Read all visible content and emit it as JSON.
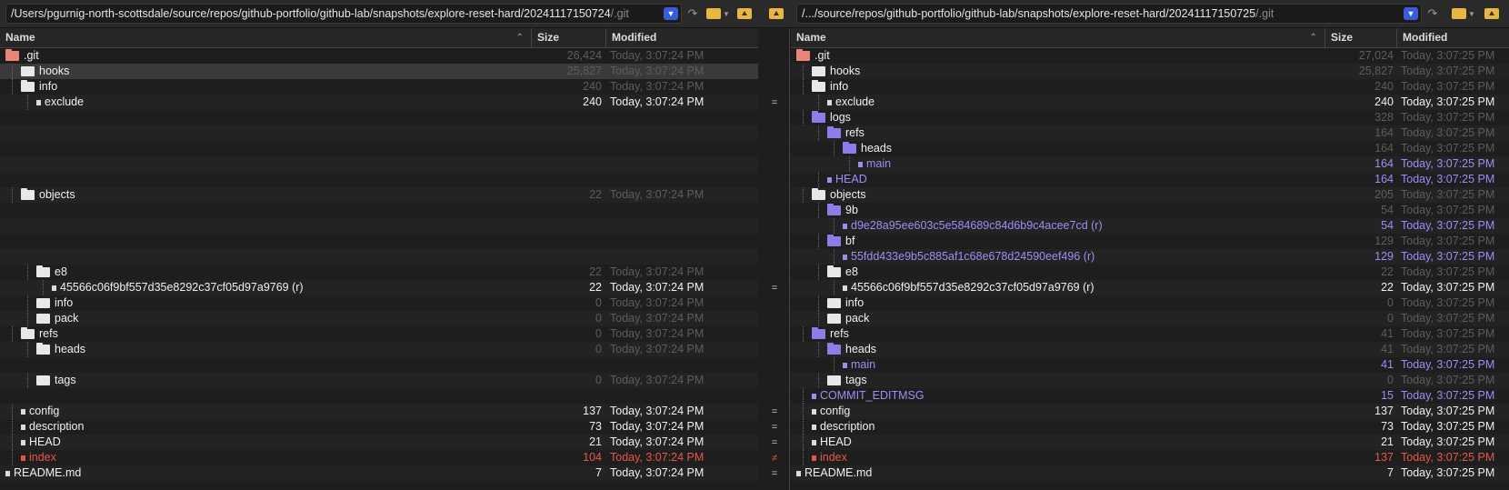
{
  "left": {
    "path_main": "/Users/pgurnig-north-scottsdale/source/repos/github-portfolio/github-lab/snapshots/explore-reset-hard/20241117150724",
    "path_suffix": "/.git",
    "columns": {
      "name": "Name",
      "size": "Size",
      "modified": "Modified"
    },
    "rows": [
      {
        "name": ".git",
        "size": "26,424",
        "mod": "Today, 3:07:24 PM",
        "indent": 0,
        "kind": "folder-git",
        "color": "dim"
      },
      {
        "name": "hooks",
        "size": "25,827",
        "mod": "Today, 3:07:24 PM",
        "indent": 1,
        "kind": "folder",
        "color": "dim",
        "selected": true
      },
      {
        "name": "info",
        "size": "240",
        "mod": "Today, 3:07:24 PM",
        "indent": 1,
        "kind": "folder-open",
        "color": "dim"
      },
      {
        "name": "exclude",
        "size": "240",
        "mod": "Today, 3:07:24 PM",
        "indent": 2,
        "kind": "file",
        "color": "same"
      },
      {
        "name": "",
        "size": "",
        "mod": "",
        "indent": 0,
        "kind": "blank"
      },
      {
        "name": "",
        "size": "",
        "mod": "",
        "indent": 0,
        "kind": "blank"
      },
      {
        "name": "",
        "size": "",
        "mod": "",
        "indent": 0,
        "kind": "blank"
      },
      {
        "name": "",
        "size": "",
        "mod": "",
        "indent": 0,
        "kind": "blank"
      },
      {
        "name": "",
        "size": "",
        "mod": "",
        "indent": 0,
        "kind": "blank"
      },
      {
        "name": "objects",
        "size": "22",
        "mod": "Today, 3:07:24 PM",
        "indent": 1,
        "kind": "folder-open",
        "color": "dim"
      },
      {
        "name": "",
        "size": "",
        "mod": "",
        "indent": 0,
        "kind": "blank"
      },
      {
        "name": "",
        "size": "",
        "mod": "",
        "indent": 0,
        "kind": "blank"
      },
      {
        "name": "",
        "size": "",
        "mod": "",
        "indent": 0,
        "kind": "blank"
      },
      {
        "name": "",
        "size": "",
        "mod": "",
        "indent": 0,
        "kind": "blank"
      },
      {
        "name": "e8",
        "size": "22",
        "mod": "Today, 3:07:24 PM",
        "indent": 2,
        "kind": "folder-open",
        "color": "dim"
      },
      {
        "name": "45566c06f9bf557d35e8292c37cf05d97a9769 (r)",
        "size": "22",
        "mod": "Today, 3:07:24 PM",
        "indent": 3,
        "kind": "file",
        "color": "same"
      },
      {
        "name": "info",
        "size": "0",
        "mod": "Today, 3:07:24 PM",
        "indent": 2,
        "kind": "folder",
        "color": "dim"
      },
      {
        "name": "pack",
        "size": "0",
        "mod": "Today, 3:07:24 PM",
        "indent": 2,
        "kind": "folder",
        "color": "dim"
      },
      {
        "name": "refs",
        "size": "0",
        "mod": "Today, 3:07:24 PM",
        "indent": 1,
        "kind": "folder-open",
        "color": "dim"
      },
      {
        "name": "heads",
        "size": "0",
        "mod": "Today, 3:07:24 PM",
        "indent": 2,
        "kind": "folder-open",
        "color": "dim"
      },
      {
        "name": "",
        "size": "",
        "mod": "",
        "indent": 0,
        "kind": "blank"
      },
      {
        "name": "tags",
        "size": "0",
        "mod": "Today, 3:07:24 PM",
        "indent": 2,
        "kind": "folder",
        "color": "dim"
      },
      {
        "name": "",
        "size": "",
        "mod": "",
        "indent": 0,
        "kind": "blank"
      },
      {
        "name": "config",
        "size": "137",
        "mod": "Today, 3:07:24 PM",
        "indent": 1,
        "kind": "file",
        "color": "same"
      },
      {
        "name": "description",
        "size": "73",
        "mod": "Today, 3:07:24 PM",
        "indent": 1,
        "kind": "file",
        "color": "same"
      },
      {
        "name": "HEAD",
        "size": "21",
        "mod": "Today, 3:07:24 PM",
        "indent": 1,
        "kind": "file",
        "color": "same"
      },
      {
        "name": "index",
        "size": "104",
        "mod": "Today, 3:07:24 PM",
        "indent": 1,
        "kind": "file-red",
        "color": "red"
      },
      {
        "name": "README.md",
        "size": "7",
        "mod": "Today, 3:07:24 PM",
        "indent": 0,
        "kind": "file",
        "color": "same"
      }
    ]
  },
  "right": {
    "path_main": "/.../source/repos/github-portfolio/github-lab/snapshots/explore-reset-hard/20241117150725",
    "path_suffix": "/.git",
    "columns": {
      "name": "Name",
      "size": "Size",
      "modified": "Modified"
    },
    "rows": [
      {
        "name": ".git",
        "size": "27,024",
        "mod": "Today, 3:07:25 PM",
        "indent": 0,
        "kind": "folder-git",
        "color": "dim"
      },
      {
        "name": "hooks",
        "size": "25,827",
        "mod": "Today, 3:07:25 PM",
        "indent": 1,
        "kind": "folder",
        "color": "dim"
      },
      {
        "name": "info",
        "size": "240",
        "mod": "Today, 3:07:25 PM",
        "indent": 1,
        "kind": "folder-open",
        "color": "dim"
      },
      {
        "name": "exclude",
        "size": "240",
        "mod": "Today, 3:07:25 PM",
        "indent": 2,
        "kind": "file",
        "color": "same"
      },
      {
        "name": "logs",
        "size": "328",
        "mod": "Today, 3:07:25 PM",
        "indent": 1,
        "kind": "folder-purple",
        "color": "dim"
      },
      {
        "name": "refs",
        "size": "164",
        "mod": "Today, 3:07:25 PM",
        "indent": 2,
        "kind": "folder-purple",
        "color": "dim"
      },
      {
        "name": "heads",
        "size": "164",
        "mod": "Today, 3:07:25 PM",
        "indent": 3,
        "kind": "folder-purple",
        "color": "dim"
      },
      {
        "name": "main",
        "size": "164",
        "mod": "Today, 3:07:25 PM",
        "indent": 4,
        "kind": "file-purple",
        "color": "purple"
      },
      {
        "name": "HEAD",
        "size": "164",
        "mod": "Today, 3:07:25 PM",
        "indent": 2,
        "kind": "file-purple",
        "color": "purple"
      },
      {
        "name": "objects",
        "size": "205",
        "mod": "Today, 3:07:25 PM",
        "indent": 1,
        "kind": "folder-open",
        "color": "dim"
      },
      {
        "name": "9b",
        "size": "54",
        "mod": "Today, 3:07:25 PM",
        "indent": 2,
        "kind": "folder-purple",
        "color": "dim"
      },
      {
        "name": "d9e28a95ee603c5e584689c84d6b9c4acee7cd (r)",
        "size": "54",
        "mod": "Today, 3:07:25 PM",
        "indent": 3,
        "kind": "file-purple",
        "color": "purple"
      },
      {
        "name": "bf",
        "size": "129",
        "mod": "Today, 3:07:25 PM",
        "indent": 2,
        "kind": "folder-purple",
        "color": "dim"
      },
      {
        "name": "55fdd433e9b5c885af1c68e678d24590eef496 (r)",
        "size": "129",
        "mod": "Today, 3:07:25 PM",
        "indent": 3,
        "kind": "file-purple",
        "color": "purple"
      },
      {
        "name": "e8",
        "size": "22",
        "mod": "Today, 3:07:25 PM",
        "indent": 2,
        "kind": "folder-open",
        "color": "dim"
      },
      {
        "name": "45566c06f9bf557d35e8292c37cf05d97a9769 (r)",
        "size": "22",
        "mod": "Today, 3:07:25 PM",
        "indent": 3,
        "kind": "file",
        "color": "same"
      },
      {
        "name": "info",
        "size": "0",
        "mod": "Today, 3:07:25 PM",
        "indent": 2,
        "kind": "folder",
        "color": "dim"
      },
      {
        "name": "pack",
        "size": "0",
        "mod": "Today, 3:07:25 PM",
        "indent": 2,
        "kind": "folder",
        "color": "dim"
      },
      {
        "name": "refs",
        "size": "41",
        "mod": "Today, 3:07:25 PM",
        "indent": 1,
        "kind": "folder-purple",
        "color": "dim"
      },
      {
        "name": "heads",
        "size": "41",
        "mod": "Today, 3:07:25 PM",
        "indent": 2,
        "kind": "folder-purple",
        "color": "dim"
      },
      {
        "name": "main",
        "size": "41",
        "mod": "Today, 3:07:25 PM",
        "indent": 3,
        "kind": "file-purple",
        "color": "purple"
      },
      {
        "name": "tags",
        "size": "0",
        "mod": "Today, 3:07:25 PM",
        "indent": 2,
        "kind": "folder",
        "color": "dim"
      },
      {
        "name": "COMMIT_EDITMSG",
        "size": "15",
        "mod": "Today, 3:07:25 PM",
        "indent": 1,
        "kind": "file-purple",
        "color": "purple"
      },
      {
        "name": "config",
        "size": "137",
        "mod": "Today, 3:07:25 PM",
        "indent": 1,
        "kind": "file",
        "color": "same"
      },
      {
        "name": "description",
        "size": "73",
        "mod": "Today, 3:07:25 PM",
        "indent": 1,
        "kind": "file",
        "color": "same"
      },
      {
        "name": "HEAD",
        "size": "21",
        "mod": "Today, 3:07:25 PM",
        "indent": 1,
        "kind": "file",
        "color": "same"
      },
      {
        "name": "index",
        "size": "137",
        "mod": "Today, 3:07:25 PM",
        "indent": 1,
        "kind": "file-red",
        "color": "red"
      },
      {
        "name": "README.md",
        "size": "7",
        "mod": "Today, 3:07:25 PM",
        "indent": 0,
        "kind": "file",
        "color": "same"
      }
    ]
  },
  "compare_marks": [
    "",
    "",
    "",
    "=",
    "",
    "",
    "",
    "",
    "",
    "",
    "",
    "",
    "",
    "",
    "",
    "=",
    "",
    "",
    "",
    "",
    "",
    "",
    "",
    "=",
    "=",
    "=",
    "≠",
    "="
  ],
  "icons": {
    "dropdown": "chevron-down-icon",
    "refresh": "refresh-icon",
    "open_folder": "folder-icon",
    "parent_folder": "parent-folder-icon",
    "swap": "swap-panes-icon"
  },
  "colors": {
    "same": "#f0f0f0",
    "dim": "#5d5d5d",
    "different": "#9d8ef5",
    "mismatch": "#e6584b"
  }
}
